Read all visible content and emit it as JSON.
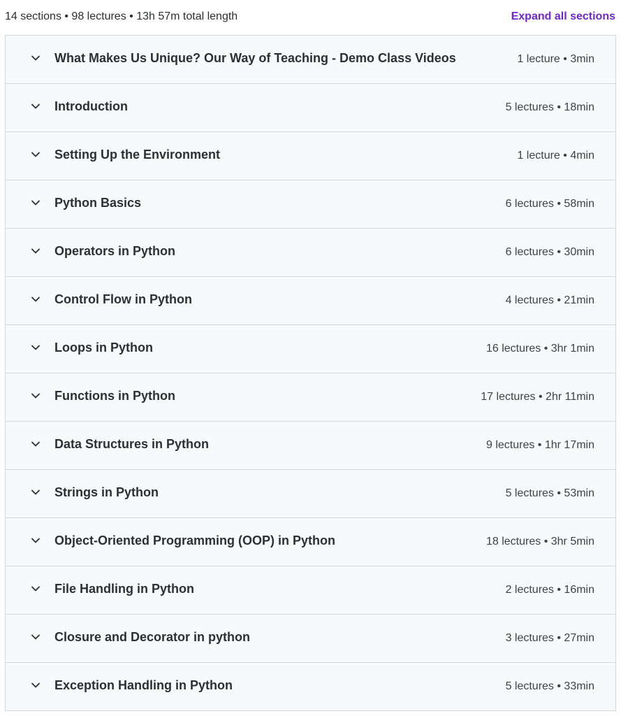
{
  "header": {
    "summary": "14 sections • 98 lectures • 13h 57m total length",
    "expand_all_label": "Expand all sections"
  },
  "colors": {
    "accent": "#6d28d2",
    "section_bg": "#f7f9fa",
    "border": "#d1d7dc",
    "text": "#2d2f31"
  },
  "sections": [
    {
      "title": "What Makes Us Unique? Our Way of Teaching - Demo Class Videos",
      "meta": "1 lecture • 3min",
      "icon": "chevron-down-icon"
    },
    {
      "title": "Introduction",
      "meta": "5 lectures • 18min",
      "icon": "chevron-down-icon"
    },
    {
      "title": "Setting Up the Environment",
      "meta": "1 lecture • 4min",
      "icon": "chevron-down-icon"
    },
    {
      "title": "Python Basics",
      "meta": "6 lectures • 58min",
      "icon": "chevron-down-icon"
    },
    {
      "title": "Operators in Python",
      "meta": "6 lectures • 30min",
      "icon": "chevron-down-icon"
    },
    {
      "title": "Control Flow in Python",
      "meta": "4 lectures • 21min",
      "icon": "chevron-down-icon"
    },
    {
      "title": "Loops in Python",
      "meta": "16 lectures • 3hr 1min",
      "icon": "chevron-down-icon"
    },
    {
      "title": "Functions in Python",
      "meta": "17 lectures • 2hr 11min",
      "icon": "chevron-down-icon"
    },
    {
      "title": "Data Structures in Python",
      "meta": "9 lectures • 1hr 17min",
      "icon": "chevron-down-icon"
    },
    {
      "title": "Strings in Python",
      "meta": "5 lectures • 53min",
      "icon": "chevron-down-icon"
    },
    {
      "title": "Object-Oriented Programming (OOP) in Python",
      "meta": "18 lectures • 3hr 5min",
      "icon": "chevron-down-icon"
    },
    {
      "title": "File Handling in Python",
      "meta": "2 lectures • 16min",
      "icon": "chevron-down-icon"
    },
    {
      "title": "Closure and Decorator in python",
      "meta": "3 lectures • 27min",
      "icon": "chevron-down-icon"
    },
    {
      "title": "Exception Handling in Python",
      "meta": "5 lectures • 33min",
      "icon": "chevron-down-icon"
    }
  ]
}
